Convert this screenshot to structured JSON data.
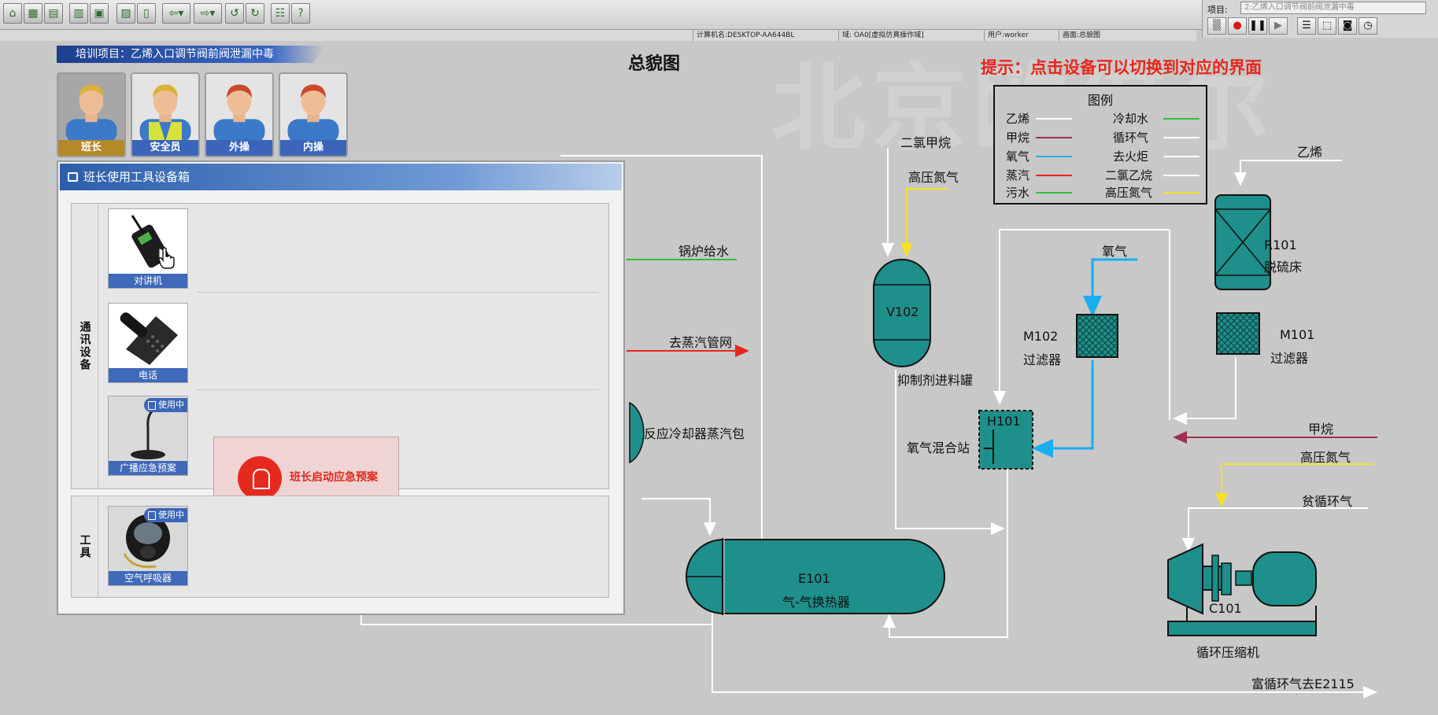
{
  "toolbar": {
    "buttons": [
      "home-icon",
      "grid-icon",
      "table-icon",
      "chart-icon",
      "monitor-icon",
      "save-icon",
      "trash-icon",
      "back-icon",
      "forward-icon",
      "refresh-icon",
      "reload-icon",
      "book-icon",
      "help-icon"
    ]
  },
  "statusbar": {
    "computer": "计算机名:DESKTOP-AA644BL",
    "domain": "域: OA0[虚拟仿真操作域]",
    "user": "用户:worker",
    "screen": "画面:总貌图"
  },
  "project": {
    "label": "项目:",
    "value": "2:乙烯入口调节阀前阀泄漏中毒"
  },
  "training": {
    "banner": "培训项目：乙烯入口调节阀前阀泄漏中毒"
  },
  "roles": [
    {
      "label": "班长",
      "hair": "#d8b23a",
      "vest": false,
      "active": true
    },
    {
      "label": "安全员",
      "hair": "#d8b23a",
      "vest": true,
      "active": false
    },
    {
      "label": "外操",
      "hair": "#c94a2a",
      "vest": false,
      "active": false
    },
    {
      "label": "内操",
      "hair": "#c94a2a",
      "vest": false,
      "active": false
    }
  ],
  "toolbox": {
    "title": "班长使用工具设备箱",
    "group_comm": "通讯设备",
    "group_tools": "工具",
    "items": {
      "radio": "对讲机",
      "phone": "电话",
      "broadcast": "广播应急预案",
      "breather": "空气呼吸器"
    },
    "in_use": "使用中",
    "emergency": "班长启动应急预案"
  },
  "diagram": {
    "title": "总貌图",
    "hint": "提示：点击设备可以切换到对应的界面",
    "watermark": "北京欧倍尔",
    "legend": {
      "title": "图例",
      "left": [
        {
          "name": "乙烯",
          "color": "#ffffff"
        },
        {
          "name": "甲烷",
          "color": "#a03050"
        },
        {
          "name": "氧气",
          "color": "#18aef0"
        },
        {
          "name": "蒸汽",
          "color": "#e8261c"
        },
        {
          "name": "污水",
          "color": "#2fbf3a"
        }
      ],
      "right": [
        {
          "name": "冷却水",
          "color": "#2fbf3a"
        },
        {
          "name": "循环气",
          "color": "#ffffff"
        },
        {
          "name": "去火炬",
          "color": "#ffffff"
        },
        {
          "name": "二氯乙烷",
          "color": "#ffffff"
        },
        {
          "name": "高压氮气",
          "color": "#f5e12a"
        }
      ]
    },
    "streams": {
      "boiler_water": "锅炉给水",
      "to_steam": "去蒸汽管网",
      "drum": "反应冷却器蒸汽包",
      "dcm": "二氯甲烷",
      "hp_n2": "高压氮气",
      "oxygen": "氧气",
      "ethylene": "乙烯",
      "methane": "甲烷",
      "hp_n2_2": "高压氮气",
      "lean_gas": "贫循环气",
      "rich_gas": "富循环气去E2115"
    },
    "equipment": {
      "v102": "V102",
      "v102_name": "抑制剂进料罐",
      "m102": "M102",
      "m102_name": "过滤器",
      "h101": "H101",
      "h101_name": "氧气混合站",
      "r101": "R101",
      "r101_name": "脱硫床",
      "m101": "M101",
      "m101_name": "过滤器",
      "e101": "E101",
      "e101_name": "气-气换热器",
      "c101": "C101",
      "c101_name": "循环压缩机"
    },
    "colors": {
      "equipment": "#1e8f8a",
      "ethylene": "#ffffff",
      "methane": "#a03050",
      "oxygen": "#18aef0",
      "steam": "#e8261c",
      "water": "#2fbf3a",
      "nitrogen": "#f5e12a"
    }
  }
}
